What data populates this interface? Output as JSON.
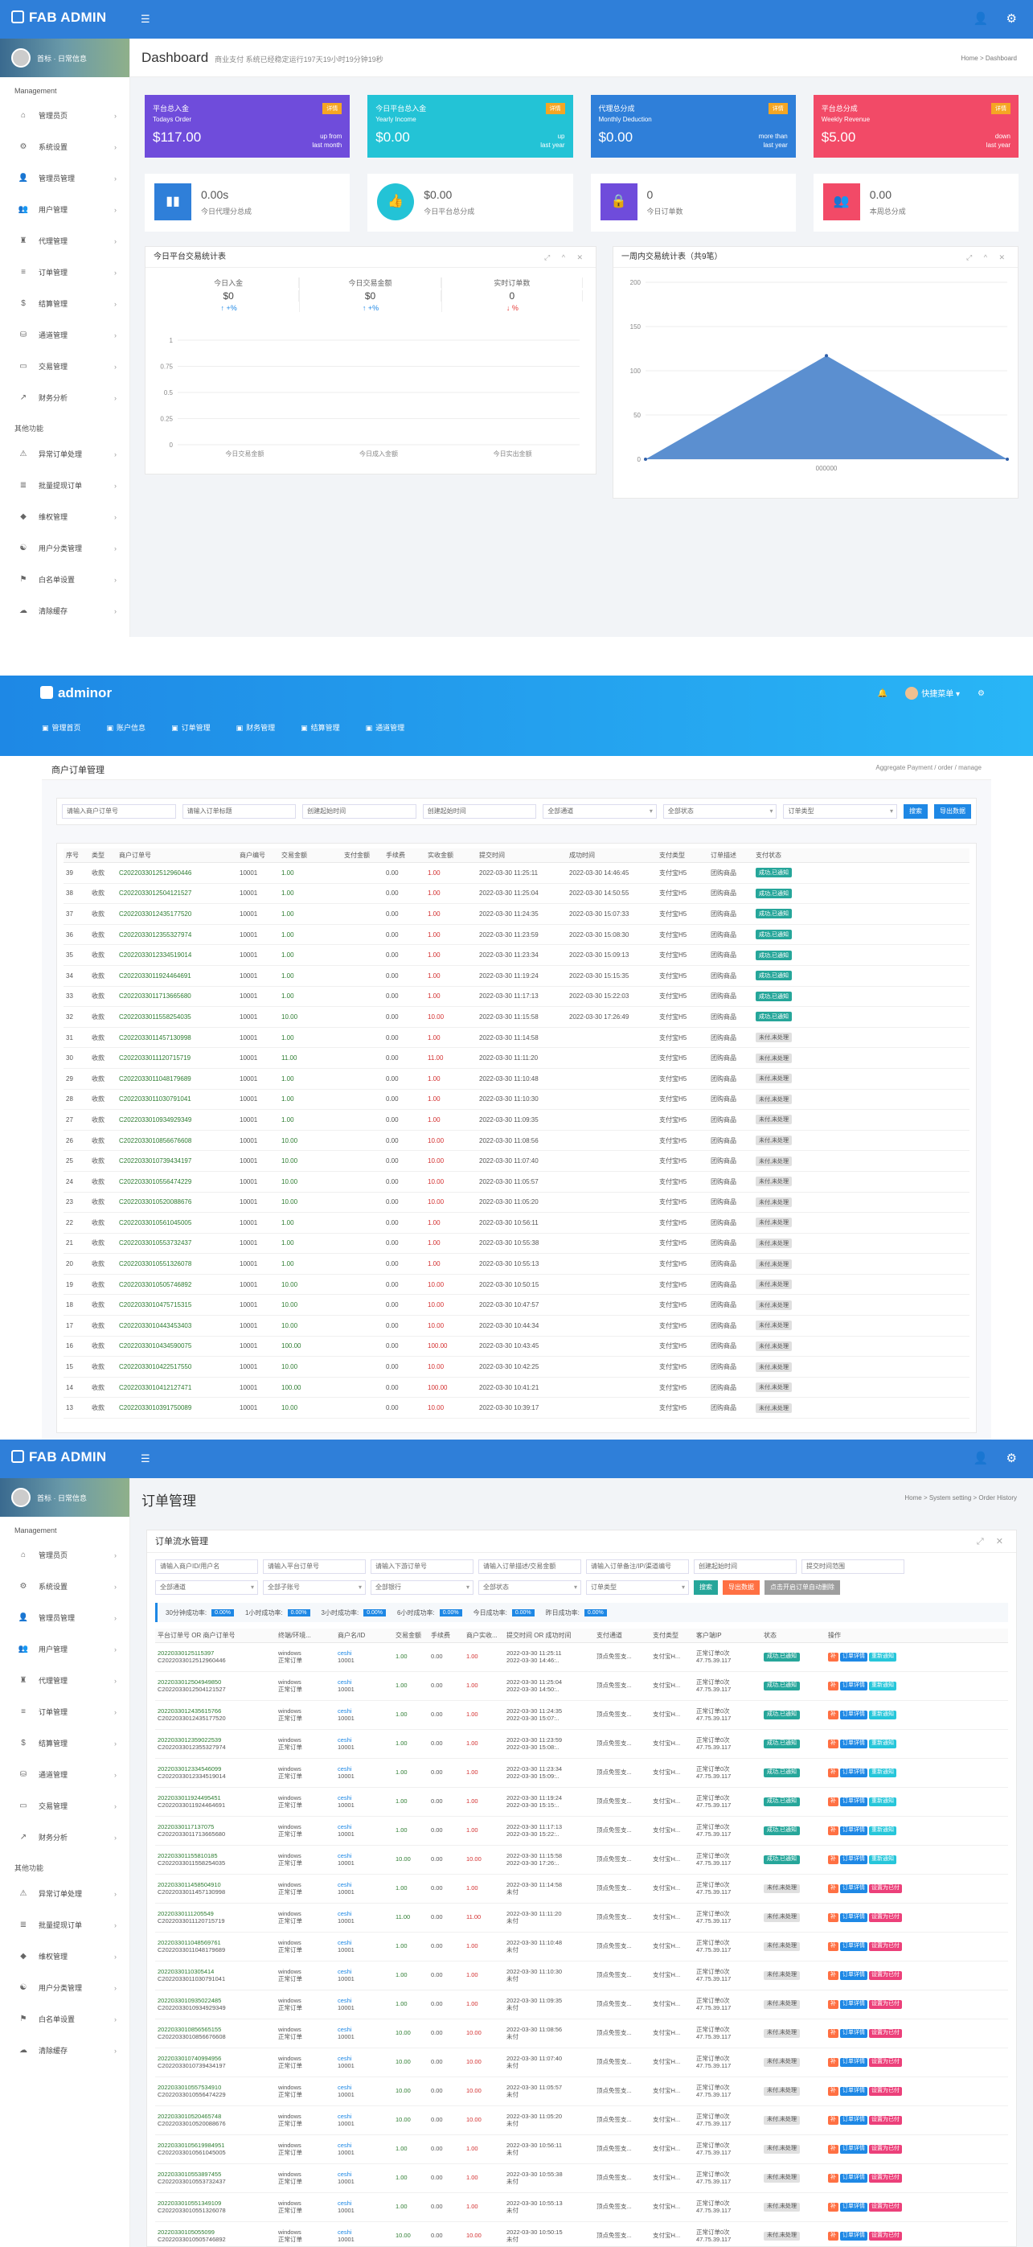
{
  "s1": {
    "brand": "FAB ADMIN",
    "user": "首标 · 日常信息",
    "menu_section": "Management",
    "menu": [
      "管理员页",
      "系统设置",
      "管理员管理",
      "用户管理",
      "代理管理",
      "订单管理",
      "结算管理",
      "通道管理",
      "交易管理",
      "财务分析"
    ],
    "menu_section2": "其他功能",
    "menu2": [
      "异常订单处理",
      "批量提现订单",
      "维权管理",
      "用户分类管理",
      "白名单设置",
      "清除缓存"
    ],
    "title": "Dashboard",
    "subtitle": "商业支付 系统已经稳定运行197天19小时19分钟19秒",
    "breadcrumb": "Home > Dashboard",
    "cards": [
      {
        "l1": "平台总入金",
        "l2": "Todays Order",
        "val": "$117.00",
        "badge": "详情",
        "r1": "up from",
        "r2": "last month",
        "color": "#6f4cdb"
      },
      {
        "l1": "今日平台总入金",
        "l2": "Yearly Income",
        "val": "$0.00",
        "badge": "详情",
        "r1": "up",
        "r2": "last year",
        "color": "#23c3d6"
      },
      {
        "l1": "代理总分成",
        "l2": "Monthly Deduction",
        "val": "$0.00",
        "badge": "详情",
        "r1": "more than",
        "r2": "last year",
        "color": "#2f7fd9"
      },
      {
        "l1": "平台总分成",
        "l2": "Weekly Revenue",
        "val": "$5.00",
        "badge": "详情",
        "r1": "down",
        "r2": "last year",
        "color": "#f24a67"
      }
    ],
    "minis": [
      {
        "v": "0.00s",
        "l": "今日代理分总成",
        "color": "#2f7fd9",
        "icon": "▮▮"
      },
      {
        "v": "$0.00",
        "l": "今日平台总分成",
        "color": "#23c3d6",
        "icon": "👍"
      },
      {
        "v": "0",
        "l": "今日订单数",
        "color": "#6f4cdb",
        "icon": "🔒"
      },
      {
        "v": "0.00",
        "l": "本周总分成",
        "color": "#f24a67",
        "icon": "👥"
      }
    ],
    "panel_left": "今日平台交易统计表",
    "panel_right": "一周内交易统计表（共9笔）",
    "stats3": [
      {
        "l": "今日入金",
        "n": "$0",
        "c": "↑ +%",
        "dir": "u"
      },
      {
        "l": "今日交易金额",
        "n": "$0",
        "c": "↑ +%",
        "dir": "u"
      },
      {
        "l": "实时订单数",
        "n": "0",
        "c": "↓ %",
        "dir": "d"
      }
    ]
  },
  "chart_left": {
    "type": "bar",
    "categories": [
      "今日交易金额",
      "今日成入金额",
      "今日实出金额"
    ],
    "values": [
      0,
      0,
      0
    ],
    "yticks": [
      "1",
      "0.75",
      "0.5",
      "0.25",
      "0"
    ],
    "ylim": [
      0,
      1
    ]
  },
  "chart_right": {
    "type": "area",
    "x": [
      "",
      "000000",
      ""
    ],
    "values": [
      0,
      117,
      0
    ],
    "yticks": [
      "200",
      "150",
      "100",
      "50",
      "0"
    ],
    "ylim": [
      0,
      200
    ],
    "color": "#5b8fd0"
  },
  "s2": {
    "brand": "adminor",
    "user": "快捷菜单",
    "nav": [
      "管理首页",
      "账户信息",
      "订单管理",
      "财务管理",
      "结算管理",
      "通道管理"
    ],
    "title": "商户订单管理",
    "breadcrumb": "Aggregate Payment / order / manage",
    "filters": [
      "请输入商户订单号",
      "请输入订单标题",
      "创建起始时间",
      "创建起始时间",
      "全部通道",
      "全部状态",
      "订单类型"
    ],
    "btn_search": "搜索",
    "btn_export": "导出数据",
    "headers": [
      "序号",
      "类型",
      "商户订单号",
      "商户编号",
      "交易金额",
      "支付金额",
      "手续费",
      "实收金额",
      "提交时间",
      "成功时间",
      "支付类型",
      "订单描述",
      "支付状态"
    ],
    "rows": [
      [
        "39",
        "收款",
        "C2022033012512960446",
        "10001",
        "1.00",
        "",
        "0.00",
        "1.00",
        "2022-03-30 11:25:11",
        "2022-03-30 14:46:45",
        "支付宝H5",
        "团购商品",
        "成功,已通知"
      ],
      [
        "38",
        "收款",
        "C2022033012504121527",
        "10001",
        "1.00",
        "",
        "0.00",
        "1.00",
        "2022-03-30 11:25:04",
        "2022-03-30 14:50:55",
        "支付宝H5",
        "团购商品",
        "成功,已通知"
      ],
      [
        "37",
        "收款",
        "C2022033012435177520",
        "10001",
        "1.00",
        "",
        "0.00",
        "1.00",
        "2022-03-30 11:24:35",
        "2022-03-30 15:07:33",
        "支付宝H5",
        "团购商品",
        "成功,已通知"
      ],
      [
        "36",
        "收款",
        "C2022033012355327974",
        "10001",
        "1.00",
        "",
        "0.00",
        "1.00",
        "2022-03-30 11:23:59",
        "2022-03-30 15:08:30",
        "支付宝H5",
        "团购商品",
        "成功,已通知"
      ],
      [
        "35",
        "收款",
        "C2022033012334519014",
        "10001",
        "1.00",
        "",
        "0.00",
        "1.00",
        "2022-03-30 11:23:34",
        "2022-03-30 15:09:13",
        "支付宝H5",
        "团购商品",
        "成功,已通知"
      ],
      [
        "34",
        "收款",
        "C2022033011924464691",
        "10001",
        "1.00",
        "",
        "0.00",
        "1.00",
        "2022-03-30 11:19:24",
        "2022-03-30 15:15:35",
        "支付宝H5",
        "团购商品",
        "成功,已通知"
      ],
      [
        "33",
        "收款",
        "C2022033011713665680",
        "10001",
        "1.00",
        "",
        "0.00",
        "1.00",
        "2022-03-30 11:17:13",
        "2022-03-30 15:22:03",
        "支付宝H5",
        "团购商品",
        "成功,已通知"
      ],
      [
        "32",
        "收款",
        "C2022033011558254035",
        "10001",
        "10.00",
        "",
        "0.00",
        "10.00",
        "2022-03-30 11:15:58",
        "2022-03-30 17:26:49",
        "支付宝H5",
        "团购商品",
        "成功,已通知"
      ],
      [
        "31",
        "收款",
        "C2022033011457130998",
        "10001",
        "1.00",
        "",
        "0.00",
        "1.00",
        "2022-03-30 11:14:58",
        "",
        "支付宝H5",
        "团购商品",
        "未付,未处理"
      ],
      [
        "30",
        "收款",
        "C2022033011120715719",
        "10001",
        "11.00",
        "",
        "0.00",
        "11.00",
        "2022-03-30 11:11:20",
        "",
        "支付宝H5",
        "团购商品",
        "未付,未处理"
      ],
      [
        "29",
        "收款",
        "C2022033011048179689",
        "10001",
        "1.00",
        "",
        "0.00",
        "1.00",
        "2022-03-30 11:10:48",
        "",
        "支付宝H5",
        "团购商品",
        "未付,未处理"
      ],
      [
        "28",
        "收款",
        "C2022033011030791041",
        "10001",
        "1.00",
        "",
        "0.00",
        "1.00",
        "2022-03-30 11:10:30",
        "",
        "支付宝H5",
        "团购商品",
        "未付,未处理"
      ],
      [
        "27",
        "收款",
        "C2022033010934929349",
        "10001",
        "1.00",
        "",
        "0.00",
        "1.00",
        "2022-03-30 11:09:35",
        "",
        "支付宝H5",
        "团购商品",
        "未付,未处理"
      ],
      [
        "26",
        "收款",
        "C2022033010856676608",
        "10001",
        "10.00",
        "",
        "0.00",
        "10.00",
        "2022-03-30 11:08:56",
        "",
        "支付宝H5",
        "团购商品",
        "未付,未处理"
      ],
      [
        "25",
        "收款",
        "C2022033010739434197",
        "10001",
        "10.00",
        "",
        "0.00",
        "10.00",
        "2022-03-30 11:07:40",
        "",
        "支付宝H5",
        "团购商品",
        "未付,未处理"
      ],
      [
        "24",
        "收款",
        "C2022033010556474229",
        "10001",
        "10.00",
        "",
        "0.00",
        "10.00",
        "2022-03-30 11:05:57",
        "",
        "支付宝H5",
        "团购商品",
        "未付,未处理"
      ],
      [
        "23",
        "收款",
        "C2022033010520088676",
        "10001",
        "10.00",
        "",
        "0.00",
        "10.00",
        "2022-03-30 11:05:20",
        "",
        "支付宝H5",
        "团购商品",
        "未付,未处理"
      ],
      [
        "22",
        "收款",
        "C2022033010561045005",
        "10001",
        "1.00",
        "",
        "0.00",
        "1.00",
        "2022-03-30 10:56:11",
        "",
        "支付宝H5",
        "团购商品",
        "未付,未处理"
      ],
      [
        "21",
        "收款",
        "C2022033010553732437",
        "10001",
        "1.00",
        "",
        "0.00",
        "1.00",
        "2022-03-30 10:55:38",
        "",
        "支付宝H5",
        "团购商品",
        "未付,未处理"
      ],
      [
        "20",
        "收款",
        "C2022033010551326078",
        "10001",
        "1.00",
        "",
        "0.00",
        "1.00",
        "2022-03-30 10:55:13",
        "",
        "支付宝H5",
        "团购商品",
        "未付,未处理"
      ],
      [
        "19",
        "收款",
        "C2022033010505746892",
        "10001",
        "10.00",
        "",
        "0.00",
        "10.00",
        "2022-03-30 10:50:15",
        "",
        "支付宝H5",
        "团购商品",
        "未付,未处理"
      ],
      [
        "18",
        "收款",
        "C2022033010475715315",
        "10001",
        "10.00",
        "",
        "0.00",
        "10.00",
        "2022-03-30 10:47:57",
        "",
        "支付宝H5",
        "团购商品",
        "未付,未处理"
      ],
      [
        "17",
        "收款",
        "C2022033010443453403",
        "10001",
        "10.00",
        "",
        "0.00",
        "10.00",
        "2022-03-30 10:44:34",
        "",
        "支付宝H5",
        "团购商品",
        "未付,未处理"
      ],
      [
        "16",
        "收款",
        "C2022033010434590075",
        "10001",
        "100.00",
        "",
        "0.00",
        "100.00",
        "2022-03-30 10:43:45",
        "",
        "支付宝H5",
        "团购商品",
        "未付,未处理"
      ],
      [
        "15",
        "收款",
        "C2022033010422517550",
        "10001",
        "10.00",
        "",
        "0.00",
        "10.00",
        "2022-03-30 10:42:25",
        "",
        "支付宝H5",
        "团购商品",
        "未付,未处理"
      ],
      [
        "14",
        "收款",
        "C2022033010412127471",
        "10001",
        "100.00",
        "",
        "0.00",
        "100.00",
        "2022-03-30 10:41:21",
        "",
        "支付宝H5",
        "团购商品",
        "未付,未处理"
      ],
      [
        "13",
        "收款",
        "C2022033010391750089",
        "10001",
        "10.00",
        "",
        "0.00",
        "10.00",
        "2022-03-30 10:39:17",
        "",
        "支付宝H5",
        "团购商品",
        "未付,未处理"
      ]
    ]
  },
  "s3": {
    "brand": "FAB ADMIN",
    "title": "订单管理",
    "breadcrumb": "Home > System setting > Order History",
    "panel": "订单流水管理",
    "filters1": [
      "请输入商户ID/用户名",
      "请输入平台订单号",
      "请输入下游订单号",
      "请输入订单描述/交易金额",
      "请输入订单备注/IP/渠道编号",
      "创建起始时间",
      "提交时间范围"
    ],
    "filters2": [
      "全部通道",
      "全部子账号",
      "全部银行",
      "全部状态",
      "订单类型"
    ],
    "btn_search": "搜索",
    "btn_export": "导出数据",
    "btn_clear": "点击开启订单自动删除",
    "stats": [
      [
        "30分钟成功率:",
        "0.00%"
      ],
      [
        "1小时成功率:",
        "0.00%"
      ],
      [
        "3小时成功率:",
        "0.00%"
      ],
      [
        "6小时成功率:",
        "0.00%"
      ],
      [
        "今日成功率:",
        "0.00%"
      ],
      [
        "昨日成功率:",
        "0.00%"
      ]
    ],
    "headers": [
      "平台订单号 OR 商户订单号",
      "终端/环境...",
      "商户名/ID",
      "交易金额",
      "手续费",
      "商户实收...",
      "提交时间 OR 成功时间",
      "支付通道",
      "支付类型",
      "客户端IP",
      "状态",
      "操作"
    ],
    "ops": [
      "补",
      "订单详情",
      "重新通知"
    ],
    "ops_fail": [
      "补",
      "订单详情",
      "设置为已付"
    ],
    "rows": [
      [
        "20220330125115397",
        "C2022033012512960446",
        "1.00",
        "1.00",
        "2022-03-30 11:25:11",
        "2022-03-30 14:46:..",
        "成功,已通知"
      ],
      [
        "2022033012504949850",
        "C2022033012504121527",
        "1.00",
        "1.00",
        "2022-03-30 11:25:04",
        "2022-03-30 14:50:..",
        "成功,已通知"
      ],
      [
        "2022033012435615766",
        "C2022033012435177520",
        "1.00",
        "1.00",
        "2022-03-30 11:24:35",
        "2022-03-30 15:07:..",
        "成功,已通知"
      ],
      [
        "2022033012359022539",
        "C2022033012355327974",
        "1.00",
        "1.00",
        "2022-03-30 11:23:59",
        "2022-03-30 15:08:..",
        "成功,已通知"
      ],
      [
        "2022033012334546099",
        "C2022033012334519014",
        "1.00",
        "1.00",
        "2022-03-30 11:23:34",
        "2022-03-30 15:09:..",
        "成功,已通知"
      ],
      [
        "2022033011924495451",
        "C2022033011924464691",
        "1.00",
        "1.00",
        "2022-03-30 11:19:24",
        "2022-03-30 15:15:..",
        "成功,已通知"
      ],
      [
        "20220330117137075",
        "C2022033011713665680",
        "1.00",
        "1.00",
        "2022-03-30 11:17:13",
        "2022-03-30 15:22:..",
        "成功,已通知"
      ],
      [
        "202203301155810185",
        "C2022033011558254035",
        "10.00",
        "10.00",
        "2022-03-30 11:15:58",
        "2022-03-30 17:26:..",
        "成功,已通知"
      ],
      [
        "2022033011458504910",
        "C2022033011457130998",
        "1.00",
        "1.00",
        "2022-03-30 11:14:58",
        "未付",
        "未付,未处理"
      ],
      [
        "20220330111205549",
        "C2022033011120715719",
        "11.00",
        "11.00",
        "2022-03-30 11:11:20",
        "未付",
        "未付,未处理"
      ],
      [
        "2022033011048569761",
        "C2022033011048179689",
        "1.00",
        "1.00",
        "2022-03-30 11:10:48",
        "未付",
        "未付,未处理"
      ],
      [
        "20220330110305414",
        "C2022033011030791041",
        "1.00",
        "1.00",
        "2022-03-30 11:10:30",
        "未付",
        "未付,未处理"
      ],
      [
        "2022033010935022485",
        "C2022033010934929349",
        "1.00",
        "1.00",
        "2022-03-30 11:09:35",
        "未付",
        "未付,未处理"
      ],
      [
        "2022033010856565155",
        "C2022033010856676608",
        "10.00",
        "10.00",
        "2022-03-30 11:08:56",
        "未付",
        "未付,未处理"
      ],
      [
        "2022033010740994956",
        "C2022033010739434197",
        "10.00",
        "10.00",
        "2022-03-30 11:07:40",
        "未付",
        "未付,未处理"
      ],
      [
        "2022033010557534910",
        "C2022033010556474229",
        "10.00",
        "10.00",
        "2022-03-30 11:05:57",
        "未付",
        "未付,未处理"
      ],
      [
        "2022033010520465748",
        "C2022033010520088676",
        "10.00",
        "10.00",
        "2022-03-30 11:05:20",
        "未付",
        "未付,未处理"
      ],
      [
        "20220330105619984951",
        "C2022033010561045005",
        "1.00",
        "1.00",
        "2022-03-30 10:56:11",
        "未付",
        "未付,未处理"
      ],
      [
        "2022033010553897455",
        "C2022033010553732437",
        "1.00",
        "1.00",
        "2022-03-30 10:55:38",
        "未付",
        "未付,未处理"
      ],
      [
        "2022033010551349109",
        "C2022033010551326078",
        "1.00",
        "1.00",
        "2022-03-30 10:55:13",
        "未付",
        "未付,未处理"
      ],
      [
        "20220330105055099",
        "C2022033010505746892",
        "10.00",
        "10.00",
        "2022-03-30 10:50:15",
        "未付",
        "未付,未处理"
      ]
    ],
    "env": [
      "windows",
      "正常订单"
    ],
    "merchant": [
      "ceshi",
      "10001"
    ],
    "fee": "0.00",
    "channel": "顶点免签支...",
    "paytype": "支付宝H...",
    "ip": [
      "正常订单0次",
      "47.75.39.117"
    ]
  }
}
